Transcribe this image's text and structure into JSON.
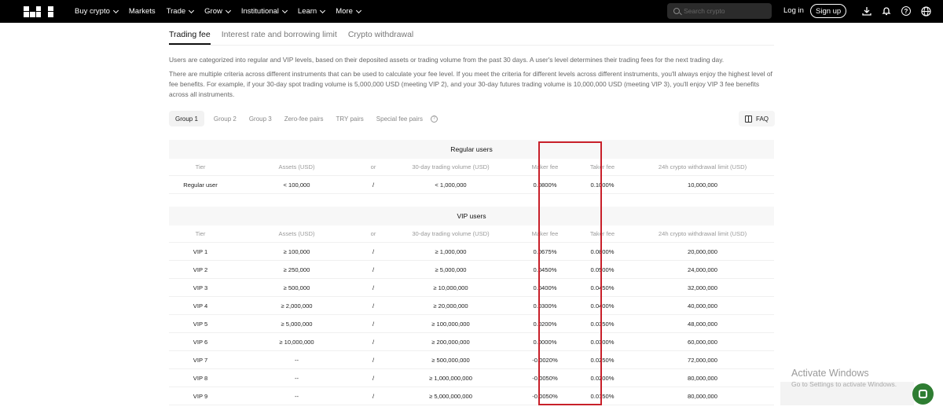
{
  "nav": {
    "brand": "OKX",
    "menu": [
      {
        "label": "Buy crypto",
        "dropdown": true
      },
      {
        "label": "Markets",
        "dropdown": false
      },
      {
        "label": "Trade",
        "dropdown": true
      },
      {
        "label": "Grow",
        "dropdown": true
      },
      {
        "label": "Institutional",
        "dropdown": true
      },
      {
        "label": "Learn",
        "dropdown": true
      },
      {
        "label": "More",
        "dropdown": true
      }
    ],
    "search_placeholder": "Search crypto",
    "login": "Log in",
    "signup": "Sign up"
  },
  "tabs": [
    {
      "label": "Trading fee",
      "active": true
    },
    {
      "label": "Interest rate and borrowing limit",
      "active": false
    },
    {
      "label": "Crypto withdrawal",
      "active": false
    }
  ],
  "intro": {
    "p1": "Users are categorized into regular and VIP levels, based on their deposited assets or trading volume from the past 30 days. A user's level determines their trading fees for the next trading day.",
    "p2": "There are multiple criteria across different instruments that can be used to calculate your fee level. If you meet the criteria for different levels across different instruments, you'll always enjoy the highest level of fee benefits. For example, if your 30-day spot trading volume is 5,000,000 USD (meeting VIP 2), and your 30-day futures trading volume is 10,000,000 USD (meeting VIP 3), you'll enjoy VIP 3 fee benefits across all instruments."
  },
  "groups": [
    {
      "label": "Group 1",
      "active": true
    },
    {
      "label": "Group 2",
      "active": false
    },
    {
      "label": "Group 3",
      "active": false
    },
    {
      "label": "Zero-fee pairs",
      "active": false
    },
    {
      "label": "TRY pairs",
      "active": false
    },
    {
      "label": "Special fee pairs",
      "active": false
    }
  ],
  "faq_label": "FAQ",
  "columns": [
    "Tier",
    "Assets (USD)",
    "or",
    "30-day trading volume (USD)",
    "Maker fee",
    "Taker fee",
    "24h crypto withdrawal limit (USD)"
  ],
  "regular": {
    "title": "Regular users",
    "rows": [
      [
        "Regular user",
        "< 100,000",
        "/",
        "< 1,000,000",
        "0.0800%",
        "0.1000%",
        "10,000,000"
      ]
    ]
  },
  "vip": {
    "title": "VIP users",
    "rows": [
      [
        "VIP 1",
        "≥ 100,000",
        "/",
        "≥ 1,000,000",
        "0.0675%",
        "0.0800%",
        "20,000,000"
      ],
      [
        "VIP 2",
        "≥ 250,000",
        "/",
        "≥ 5,000,000",
        "0.0450%",
        "0.0500%",
        "24,000,000"
      ],
      [
        "VIP 3",
        "≥ 500,000",
        "/",
        "≥ 10,000,000",
        "0.0400%",
        "0.0450%",
        "32,000,000"
      ],
      [
        "VIP 4",
        "≥ 2,000,000",
        "/",
        "≥ 20,000,000",
        "0.0300%",
        "0.0400%",
        "40,000,000"
      ],
      [
        "VIP 5",
        "≥ 5,000,000",
        "/",
        "≥ 100,000,000",
        "0.0200%",
        "0.0350%",
        "48,000,000"
      ],
      [
        "VIP 6",
        "≥ 10,000,000",
        "/",
        "≥ 200,000,000",
        "0.0000%",
        "0.0300%",
        "60,000,000"
      ],
      [
        "VIP 7",
        "--",
        "/",
        "≥ 500,000,000",
        "-0.0020%",
        "0.0250%",
        "72,000,000"
      ],
      [
        "VIP 8",
        "--",
        "/",
        "≥ 1,000,000,000",
        "-0.0050%",
        "0.0200%",
        "80,000,000"
      ],
      [
        "VIP 9",
        "--",
        "/",
        "≥ 5,000,000,000",
        "-0.0050%",
        "0.0150%",
        "80,000,000"
      ]
    ]
  },
  "watermark": {
    "line1": "Activate Windows",
    "line2": "Go to Settings to activate Windows."
  },
  "colors": {
    "highlight": "#c8202a",
    "chat": "#2e7d32"
  }
}
